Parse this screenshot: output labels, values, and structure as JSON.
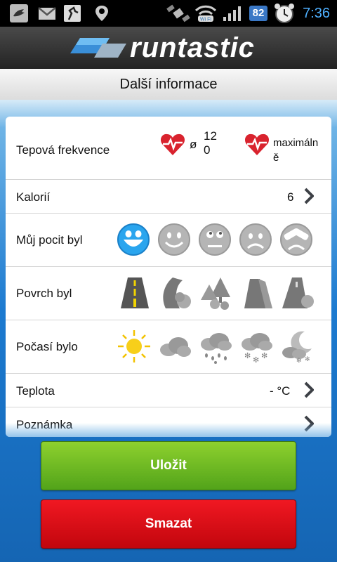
{
  "status_bar": {
    "battery": "82",
    "time": "7:36",
    "wifi_label": "Wi Fi"
  },
  "header": {
    "brand": "runtastic",
    "title": "Další informace"
  },
  "rows": {
    "heart_rate": {
      "label": "Tepová frekvence",
      "avg_symbol": "ø",
      "avg_value": "12\n0",
      "max_label": "maximáln\ně"
    },
    "calories": {
      "label": "Kalorií",
      "value": "6"
    },
    "feeling": {
      "label": "Můj pocit byl",
      "selected_index": 0
    },
    "surface": {
      "label": "Povrch byl"
    },
    "weather": {
      "label": "Počasí bylo"
    },
    "temperature": {
      "label": "Teplota",
      "value": "- °C"
    },
    "note": {
      "label": "Poznámka"
    }
  },
  "buttons": {
    "save": "Uložit",
    "delete": "Smazat"
  },
  "colors": {
    "save_green": "#6cbb22",
    "delete_red": "#e0101a",
    "heart_red": "#d9232e",
    "selected_face_blue": "#2aa5ee"
  }
}
